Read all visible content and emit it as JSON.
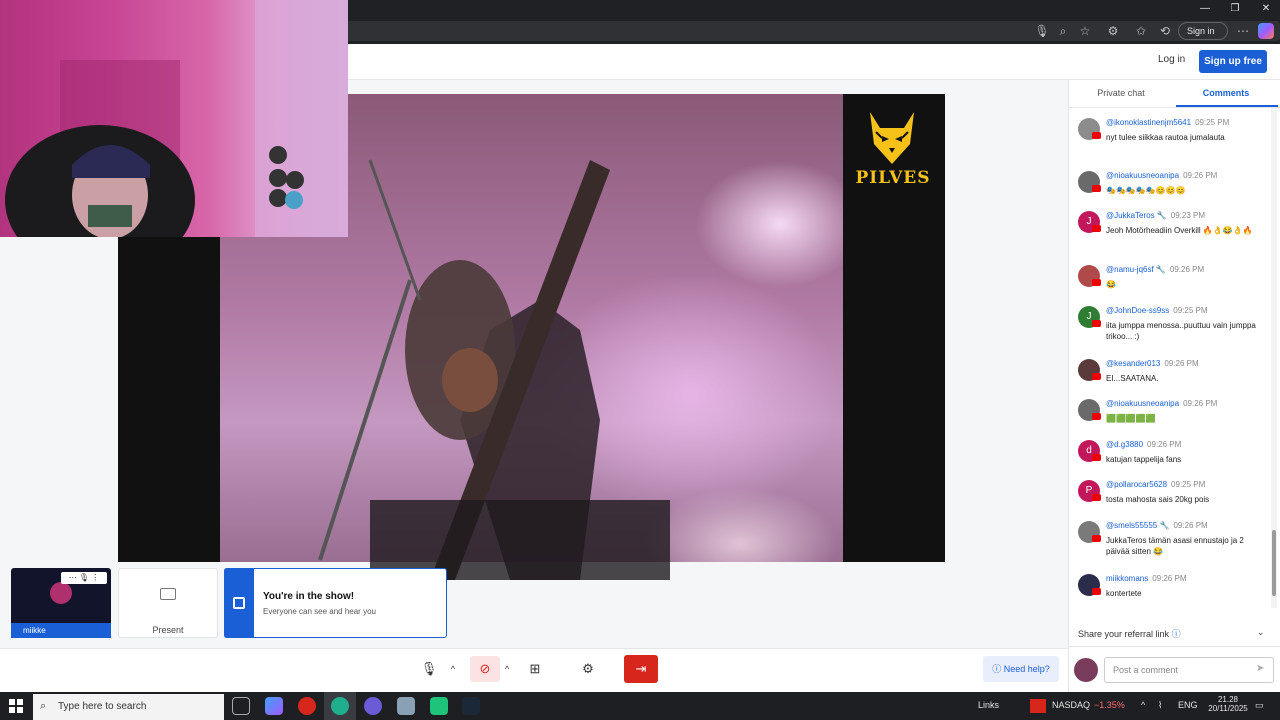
{
  "browser": {
    "signin_label": "Sign in",
    "icons": [
      "mic-icon",
      "zoom-icon",
      "favorite-icon",
      "extensions-icon",
      "favorites-icon",
      "history-icon",
      "more-icon"
    ]
  },
  "header": {
    "login_label": "Log in",
    "signup_label": "Sign up free"
  },
  "stage": {
    "logo_text": "PILVES"
  },
  "self_card": {
    "name": "miikke"
  },
  "present_card": {
    "label": "Present"
  },
  "show_notice": {
    "title": "You're in the show!",
    "subtitle": "Everyone can see and hear you"
  },
  "toolbar": {
    "help_label": "Need help?"
  },
  "panel": {
    "tab_private": "Private chat",
    "tab_comments": "Comments",
    "comments": [
      {
        "user": "@ikonoklastinenjm5641",
        "time": "09:25 PM",
        "text": "nyt tulee siikkaa rautoa jumalauta",
        "initial": "",
        "color": "#8c8c8c"
      },
      {
        "user": "@nioakuusneoanipa",
        "time": "09:26 PM",
        "text": "🎭🎭🎭🎭🎭😊😊😊",
        "initial": "",
        "color": "#6a6a6a"
      },
      {
        "user": "@JukkaTeros 🔧",
        "time": "09:23 PM",
        "text": "Jeoh Motörheadiin Overkill 🔥👌😂👌🔥",
        "initial": "J",
        "color": "#c2185b"
      },
      {
        "user": "@namu-jq6sf 🔧",
        "time": "09:26 PM",
        "text": "😂",
        "initial": "",
        "color": "#b04a4a"
      },
      {
        "user": "@JohnDoe-ss9ss",
        "time": "09:25 PM",
        "text": "iita jumppa menossa..puuttuu vain jumppa trikoo... :)",
        "initial": "J",
        "color": "#2e7d32"
      },
      {
        "user": "@kesander013",
        "time": "09:26 PM",
        "text": "EI...SAATANA.",
        "initial": "",
        "color": "#5a3a3a"
      },
      {
        "user": "@nioakuusneoanipa",
        "time": "09:26 PM",
        "text": "🟩🟩🟩🟩🟩",
        "initial": "",
        "color": "#6a6a6a"
      },
      {
        "user": "@d.g3880",
        "time": "09:26 PM",
        "text": "katujan tappelija fans",
        "initial": "d",
        "color": "#c2185b"
      },
      {
        "user": "@pollarocar5628",
        "time": "09:25 PM",
        "text": "tosta mahosta sais 20kg pois",
        "initial": "P",
        "color": "#c2185b"
      },
      {
        "user": "@smels55555 🔧",
        "time": "09:26 PM",
        "text": "JukkaTeros tämän asasi ennustajo ja 2 päivää sitten 😂",
        "initial": "",
        "color": "#7a7a7a"
      },
      {
        "user": "miikkomans",
        "time": "09:26 PM",
        "text": "kontertete",
        "initial": "",
        "color": "#2b2b4a"
      }
    ],
    "referral_label": "Share your referral link",
    "comment_placeholder": "Post a comment"
  },
  "taskbar": {
    "search_placeholder": "Type here to search",
    "links_label": "Links",
    "ticker_name": "NASDAQ",
    "ticker_change": "−1.35%",
    "lang": "ENG",
    "time": "21.28",
    "date": "20/11/2025"
  },
  "colors": {
    "accent": "#1a5fd6",
    "leave": "#d7261c",
    "logo": "#f6c21a"
  }
}
